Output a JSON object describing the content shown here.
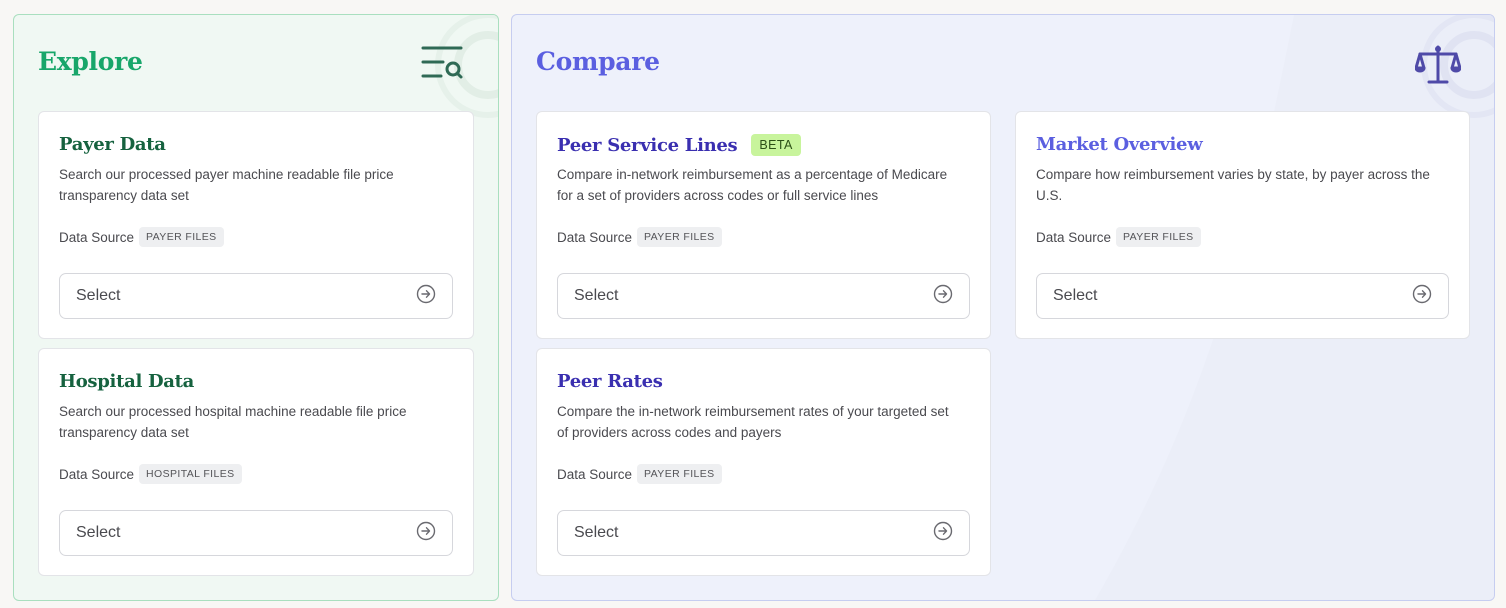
{
  "explore": {
    "title": "Explore",
    "icon": "list-search-icon",
    "accent": "#18a66a",
    "cards": [
      {
        "title": "Payer Data",
        "description": "Search our processed payer machine readable file price transparency data set",
        "source_label": "Data Source",
        "source_tag": "PAYER FILES",
        "select_label": "Select"
      },
      {
        "title": "Hospital Data",
        "description": "Search our processed hospital machine readable file price transparency data set",
        "source_label": "Data Source",
        "source_tag": "HOSPITAL FILES",
        "select_label": "Select"
      }
    ]
  },
  "compare": {
    "title": "Compare",
    "icon": "scale-icon",
    "accent": "#5b5fe0",
    "cards": [
      {
        "title": "Peer Service Lines",
        "badge": "BETA",
        "description": "Compare in-network reimbursement as a percentage of Medicare for a set of providers across codes or full service lines",
        "source_label": "Data Source",
        "source_tag": "PAYER FILES",
        "select_label": "Select"
      },
      {
        "title": "Market Overview",
        "description": "Compare how reimbursement varies by state, by payer across the U.S.",
        "source_label": "Data Source",
        "source_tag": "PAYER FILES",
        "select_label": "Select"
      },
      {
        "title": "Peer Rates",
        "description": "Compare the in-network reimbursement rates of your targeted set of providers across codes and payers",
        "source_label": "Data Source",
        "source_tag": "PAYER FILES",
        "select_label": "Select"
      }
    ]
  }
}
